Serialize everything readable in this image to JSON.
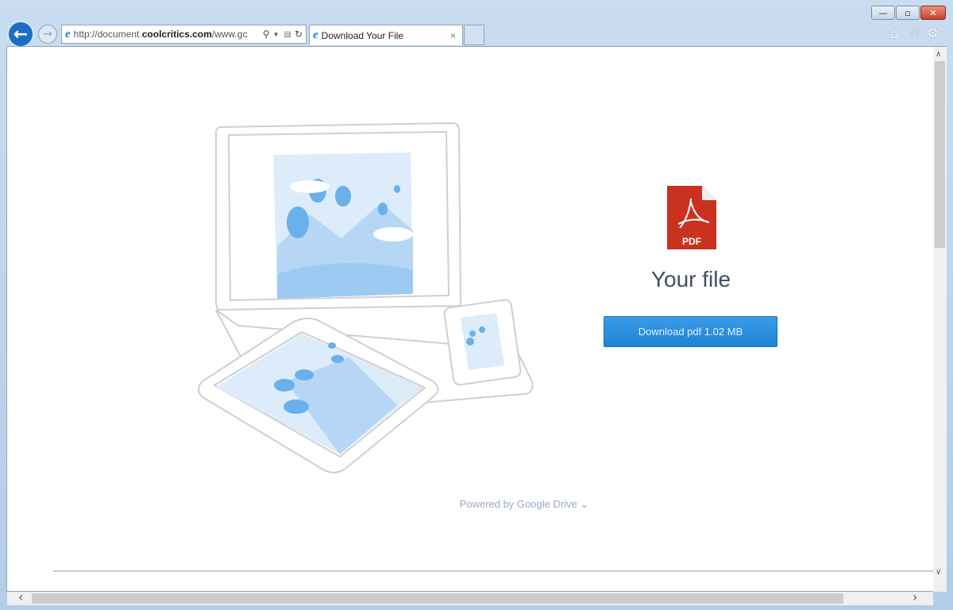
{
  "browser": {
    "address": {
      "prefix": "http://document.",
      "domain": "coolcritics.com",
      "suffix": "/www.gc"
    },
    "tab": {
      "title": "Download Your File",
      "close": "×"
    },
    "window_buttons": {
      "minimize": "—",
      "maximize": "▫",
      "close": "✕"
    },
    "icons": {
      "back": "←",
      "forward": "→",
      "search": "⚲",
      "home": "⌂",
      "favorites": "☆",
      "settings": "⚙"
    }
  },
  "page": {
    "file_icon": "PDF",
    "title": "Your file",
    "download_button": "Download pdf 1.02 MB",
    "powered_by": "Powered by Google Drive",
    "powered_chevron": "⌄"
  },
  "scrollbars": {
    "up": "∧",
    "down": "∨",
    "left": "‹",
    "right": "›"
  },
  "colors": {
    "accent": "#2a8de0",
    "pdf_red": "#c8321f",
    "frame": "#b9d1ea"
  }
}
